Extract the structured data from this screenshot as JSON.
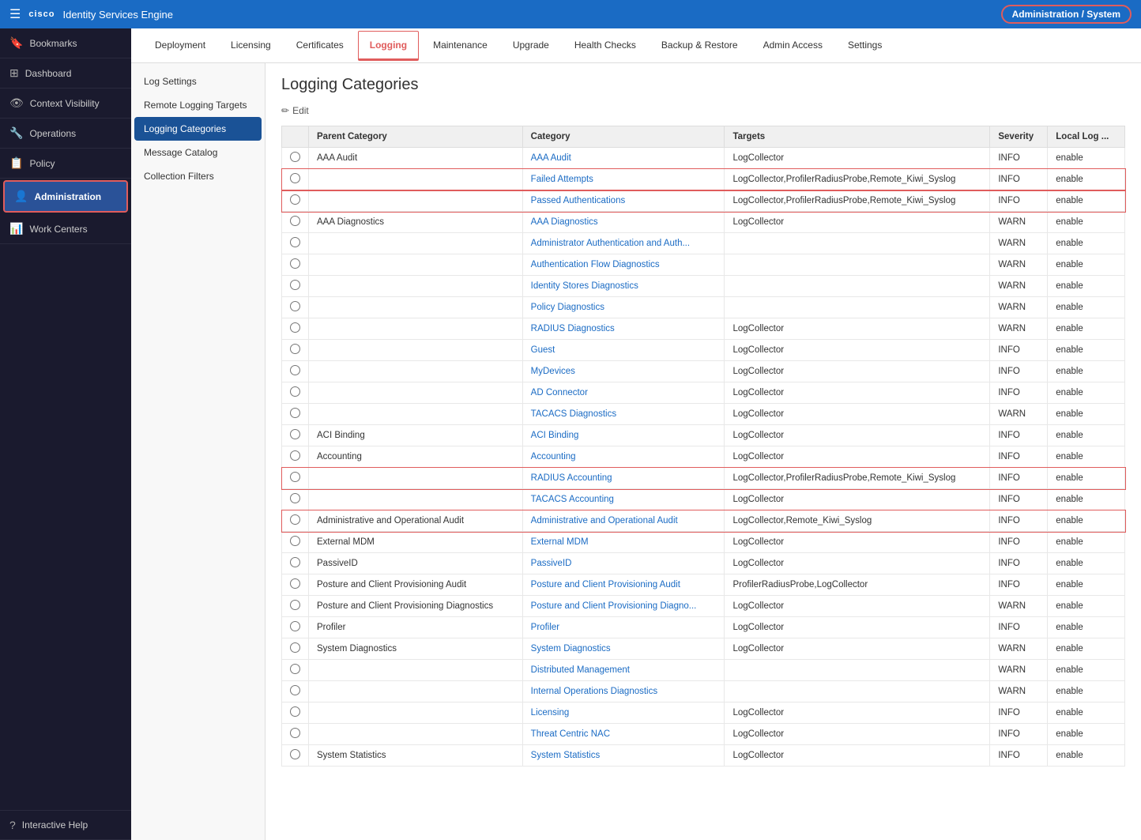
{
  "header": {
    "app_title": "Identity Services Engine",
    "admin_badge": "Administration / System",
    "hamburger": "☰",
    "cisco_logo": "cisco"
  },
  "sidebar": {
    "items": [
      {
        "id": "bookmarks",
        "label": "Bookmarks",
        "icon": "🔖",
        "active": false
      },
      {
        "id": "dashboard",
        "label": "Dashboard",
        "icon": "⊞",
        "active": false
      },
      {
        "id": "context-visibility",
        "label": "Context Visibility",
        "icon": "👁",
        "active": false
      },
      {
        "id": "operations",
        "label": "Operations",
        "icon": "🔧",
        "active": false
      },
      {
        "id": "policy",
        "label": "Policy",
        "icon": "📋",
        "active": false
      },
      {
        "id": "administration",
        "label": "Administration",
        "icon": "👤",
        "active": true
      },
      {
        "id": "work-centers",
        "label": "Work Centers",
        "icon": "📊",
        "active": false
      }
    ],
    "interactive_help": "Interactive Help"
  },
  "tabs": {
    "items": [
      {
        "id": "deployment",
        "label": "Deployment",
        "active": false
      },
      {
        "id": "licensing",
        "label": "Licensing",
        "active": false
      },
      {
        "id": "certificates",
        "label": "Certificates",
        "active": false
      },
      {
        "id": "logging",
        "label": "Logging",
        "active": true
      },
      {
        "id": "maintenance",
        "label": "Maintenance",
        "active": false
      },
      {
        "id": "upgrade",
        "label": "Upgrade",
        "active": false
      },
      {
        "id": "health-checks",
        "label": "Health Checks",
        "active": false
      },
      {
        "id": "backup-restore",
        "label": "Backup & Restore",
        "active": false
      },
      {
        "id": "admin-access",
        "label": "Admin Access",
        "active": false
      },
      {
        "id": "settings",
        "label": "Settings",
        "active": false
      }
    ]
  },
  "sub_sidebar": {
    "items": [
      {
        "id": "log-settings",
        "label": "Log Settings",
        "active": false
      },
      {
        "id": "remote-logging",
        "label": "Remote Logging Targets",
        "active": false
      },
      {
        "id": "logging-categories",
        "label": "Logging Categories",
        "active": true
      },
      {
        "id": "message-catalog",
        "label": "Message Catalog",
        "active": false
      },
      {
        "id": "collection-filters",
        "label": "Collection Filters",
        "active": false
      }
    ]
  },
  "page": {
    "title": "Logging Categories",
    "edit_label": "Edit"
  },
  "table": {
    "columns": [
      "",
      "Parent Category",
      "Category",
      "Targets",
      "Severity",
      "Local Log ..."
    ],
    "rows": [
      {
        "id": "r1",
        "parent": "AAA Audit",
        "category": "AAA Audit",
        "targets": "LogCollector",
        "severity": "INFO",
        "local_log": "enable",
        "highlighted": false,
        "category_link": true
      },
      {
        "id": "r2",
        "parent": "",
        "category": "Failed Attempts",
        "targets": "LogCollector,ProfilerRadiusProbe,Remote_Kiwi_Syslog",
        "severity": "INFO",
        "local_log": "enable",
        "highlighted": true,
        "category_link": true
      },
      {
        "id": "r3",
        "parent": "",
        "category": "Passed Authentications",
        "targets": "LogCollector,ProfilerRadiusProbe,Remote_Kiwi_Syslog",
        "severity": "INFO",
        "local_log": "enable",
        "highlighted": true,
        "category_link": true
      },
      {
        "id": "r4",
        "parent": "AAA Diagnostics",
        "category": "AAA Diagnostics",
        "targets": "LogCollector",
        "severity": "WARN",
        "local_log": "enable",
        "highlighted": false,
        "category_link": true
      },
      {
        "id": "r5",
        "parent": "",
        "category": "Administrator Authentication and Auth...",
        "targets": "",
        "severity": "WARN",
        "local_log": "enable",
        "highlighted": false,
        "category_link": true
      },
      {
        "id": "r6",
        "parent": "",
        "category": "Authentication Flow Diagnostics",
        "targets": "",
        "severity": "WARN",
        "local_log": "enable",
        "highlighted": false,
        "category_link": true
      },
      {
        "id": "r7",
        "parent": "",
        "category": "Identity Stores Diagnostics",
        "targets": "",
        "severity": "WARN",
        "local_log": "enable",
        "highlighted": false,
        "category_link": true
      },
      {
        "id": "r8",
        "parent": "",
        "category": "Policy Diagnostics",
        "targets": "",
        "severity": "WARN",
        "local_log": "enable",
        "highlighted": false,
        "category_link": true
      },
      {
        "id": "r9",
        "parent": "",
        "category": "RADIUS Diagnostics",
        "targets": "LogCollector",
        "severity": "WARN",
        "local_log": "enable",
        "highlighted": false,
        "category_link": true
      },
      {
        "id": "r10",
        "parent": "",
        "category": "Guest",
        "targets": "LogCollector",
        "severity": "INFO",
        "local_log": "enable",
        "highlighted": false,
        "category_link": true
      },
      {
        "id": "r11",
        "parent": "",
        "category": "MyDevices",
        "targets": "LogCollector",
        "severity": "INFO",
        "local_log": "enable",
        "highlighted": false,
        "category_link": true
      },
      {
        "id": "r12",
        "parent": "",
        "category": "AD Connector",
        "targets": "LogCollector",
        "severity": "INFO",
        "local_log": "enable",
        "highlighted": false,
        "category_link": true
      },
      {
        "id": "r13",
        "parent": "",
        "category": "TACACS Diagnostics",
        "targets": "LogCollector",
        "severity": "WARN",
        "local_log": "enable",
        "highlighted": false,
        "category_link": true
      },
      {
        "id": "r14",
        "parent": "ACI Binding",
        "category": "ACI Binding",
        "targets": "LogCollector",
        "severity": "INFO",
        "local_log": "enable",
        "highlighted": false,
        "category_link": true
      },
      {
        "id": "r15",
        "parent": "Accounting",
        "category": "Accounting",
        "targets": "LogCollector",
        "severity": "INFO",
        "local_log": "enable",
        "highlighted": false,
        "category_link": true
      },
      {
        "id": "r16",
        "parent": "",
        "category": "RADIUS Accounting",
        "targets": "LogCollector,ProfilerRadiusProbe,Remote_Kiwi_Syslog",
        "severity": "INFO",
        "local_log": "enable",
        "highlighted": true,
        "category_link": true
      },
      {
        "id": "r17",
        "parent": "",
        "category": "TACACS Accounting",
        "targets": "LogCollector",
        "severity": "INFO",
        "local_log": "enable",
        "highlighted": false,
        "category_link": true
      },
      {
        "id": "r18",
        "parent": "Administrative and Operational Audit",
        "category": "Administrative and Operational Audit",
        "targets": "LogCollector,Remote_Kiwi_Syslog",
        "severity": "INFO",
        "local_log": "enable",
        "highlighted": true,
        "category_link": true
      },
      {
        "id": "r19",
        "parent": "External MDM",
        "category": "External MDM",
        "targets": "LogCollector",
        "severity": "INFO",
        "local_log": "enable",
        "highlighted": false,
        "category_link": true
      },
      {
        "id": "r20",
        "parent": "PassiveID",
        "category": "PassiveID",
        "targets": "LogCollector",
        "severity": "INFO",
        "local_log": "enable",
        "highlighted": false,
        "category_link": true
      },
      {
        "id": "r21",
        "parent": "Posture and Client Provisioning Audit",
        "category": "Posture and Client Provisioning Audit",
        "targets": "ProfilerRadiusProbe,LogCollector",
        "severity": "INFO",
        "local_log": "enable",
        "highlighted": false,
        "category_link": true
      },
      {
        "id": "r22",
        "parent": "Posture and Client Provisioning Diagnostics",
        "category": "Posture and Client Provisioning Diagno...",
        "targets": "LogCollector",
        "severity": "WARN",
        "local_log": "enable",
        "highlighted": false,
        "category_link": true
      },
      {
        "id": "r23",
        "parent": "Profiler",
        "category": "Profiler",
        "targets": "LogCollector",
        "severity": "INFO",
        "local_log": "enable",
        "highlighted": false,
        "category_link": true
      },
      {
        "id": "r24",
        "parent": "System Diagnostics",
        "category": "System Diagnostics",
        "targets": "LogCollector",
        "severity": "WARN",
        "local_log": "enable",
        "highlighted": false,
        "category_link": true
      },
      {
        "id": "r25",
        "parent": "",
        "category": "Distributed Management",
        "targets": "",
        "severity": "WARN",
        "local_log": "enable",
        "highlighted": false,
        "category_link": true
      },
      {
        "id": "r26",
        "parent": "",
        "category": "Internal Operations Diagnostics",
        "targets": "",
        "severity": "WARN",
        "local_log": "enable",
        "highlighted": false,
        "category_link": true
      },
      {
        "id": "r27",
        "parent": "",
        "category": "Licensing",
        "targets": "LogCollector",
        "severity": "INFO",
        "local_log": "enable",
        "highlighted": false,
        "category_link": true
      },
      {
        "id": "r28",
        "parent": "",
        "category": "Threat Centric NAC",
        "targets": "LogCollector",
        "severity": "INFO",
        "local_log": "enable",
        "highlighted": false,
        "category_link": true
      },
      {
        "id": "r29",
        "parent": "System Statistics",
        "category": "System Statistics",
        "targets": "LogCollector",
        "severity": "INFO",
        "local_log": "enable",
        "highlighted": false,
        "category_link": true
      }
    ]
  }
}
